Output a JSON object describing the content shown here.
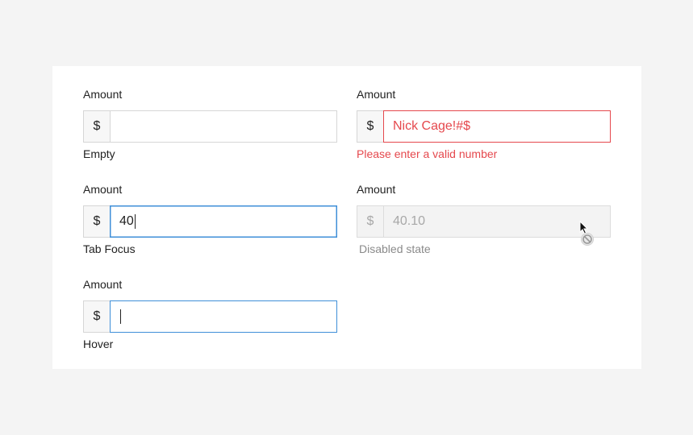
{
  "fields": [
    {
      "label": "Amount",
      "prefix": "$",
      "value": "",
      "helper": "Empty"
    },
    {
      "label": "Amount",
      "prefix": "$",
      "value": "Nick Cage!#$",
      "helper": "Please enter a valid number"
    },
    {
      "label": "Amount",
      "prefix": "$",
      "value": "40",
      "helper": "Tab Focus"
    },
    {
      "label": "Amount",
      "prefix": "$",
      "value": "40.10",
      "helper": "Disabled state"
    },
    {
      "label": "Amount",
      "prefix": "$",
      "value": "",
      "helper": "Hover"
    }
  ],
  "colors": {
    "error": "#e5484d",
    "focus": "#3f8fd8",
    "border": "#d6d6d6"
  },
  "cursor_icon": "not-allowed-cursor-icon"
}
